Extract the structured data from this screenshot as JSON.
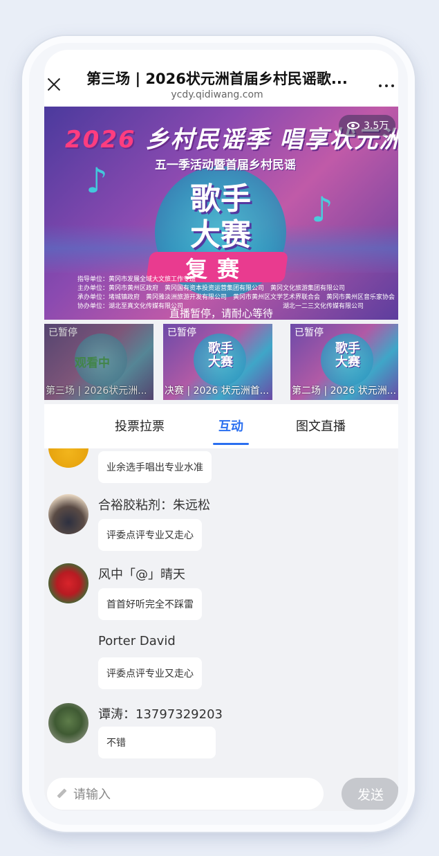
{
  "header": {
    "title": "第三场 | 2026状元洲首届乡村民谣歌...",
    "url": "ycdy.qidiwang.com"
  },
  "banner": {
    "year": "2026",
    "headline": "乡村民谣季 唱享状元洲",
    "subtitle": "五一季活动暨首届乡村民谣",
    "big_line1": "歌手",
    "big_line2": "大赛",
    "stage": "复赛",
    "organizers": [
      "指导单位：黄冈市发展全域大文旅工作专班",
      "主办单位：黄冈市黄州区政府　黄冈国有资本投资运营集团有限公司　黄冈文化旅游集团有限公司",
      "承办单位：堵城镇政府　黄冈雅淡洲旅游开发有限公司　黄冈市黄州区文学艺术界联合会　黄冈市黄州区音乐家协会",
      "协办单位：湖北至真文化传媒有限公司　　　　　　　　　　　　　　　　湖北一二三文化传媒有限公司"
    ],
    "status": "直播暂停，请耐心等待",
    "views": "3.5万"
  },
  "sessions": [
    {
      "tag": "已暂停",
      "badge": "观看中",
      "caption": "第三场 | 2026状元洲..."
    },
    {
      "tag": "已暂停",
      "caption": "决赛 | 2026 状元洲首..."
    },
    {
      "tag": "已暂停",
      "caption": "第二场 | 2026 状元洲..."
    }
  ],
  "tabs": [
    "投票拉票",
    "互动",
    "图文直播"
  ],
  "active_tab": "互动",
  "messages": [
    {
      "name": "",
      "text": "业余选手唱出专业水准"
    },
    {
      "name": "合裕胶粘剂：朱远松",
      "text": "评委点评专业又走心"
    },
    {
      "name": "风中「@」晴天",
      "text": "首首好听完全不踩雷"
    },
    {
      "name": "Porter David",
      "text": "评委点评专业又走心"
    },
    {
      "name": "谭涛：13797329203",
      "text": "不错"
    }
  ],
  "input": {
    "placeholder": "请输入",
    "send_label": "发送"
  },
  "colors": {
    "accent": "#2a6ff0",
    "send_disabled": "#c6c8cd",
    "watching": "#1fae2f"
  }
}
